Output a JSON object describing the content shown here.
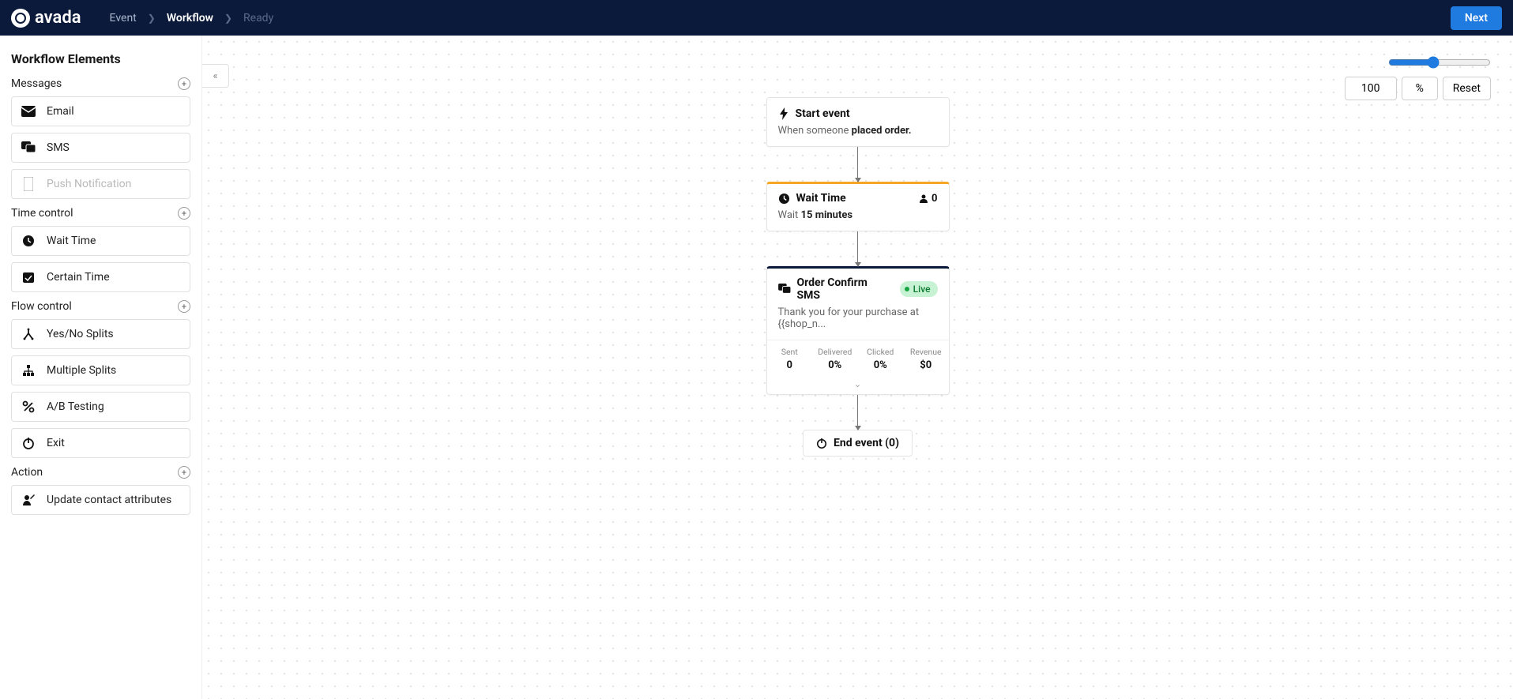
{
  "brand": "avada",
  "breadcrumbs": {
    "event": "Event",
    "workflow": "Workflow",
    "ready": "Ready"
  },
  "next_label": "Next",
  "sidebar": {
    "title": "Workflow Elements",
    "sections": {
      "messages": {
        "title": "Messages",
        "email": "Email",
        "sms": "SMS",
        "push": "Push Notification"
      },
      "time": {
        "title": "Time control",
        "wait": "Wait Time",
        "certain": "Certain Time"
      },
      "flow": {
        "title": "Flow control",
        "yesno": "Yes/No Splits",
        "multi": "Multiple Splits",
        "ab": "A/B Testing",
        "exit": "Exit"
      },
      "action": {
        "title": "Action",
        "update": "Update contact attributes"
      }
    }
  },
  "zoom": {
    "value": "100",
    "pct": "%",
    "reset": "Reset"
  },
  "flow": {
    "start": {
      "title": "Start event",
      "desc_pre": "When someone ",
      "desc_bold": "placed order."
    },
    "wait": {
      "title": "Wait Time",
      "count": "0",
      "body_pre": "Wait ",
      "body_bold": "15 minutes"
    },
    "sms": {
      "title": "Order Confirm SMS",
      "status": "Live",
      "preview": "Thank you for your purchase at {{shop_n...",
      "metrics": {
        "sent": {
          "label": "Sent",
          "value": "0"
        },
        "delivered": {
          "label": "Delivered",
          "value": "0%"
        },
        "clicked": {
          "label": "Clicked",
          "value": "0%"
        },
        "revenue": {
          "label": "Revenue",
          "value": "$0"
        }
      }
    },
    "end": "End event (0)"
  }
}
